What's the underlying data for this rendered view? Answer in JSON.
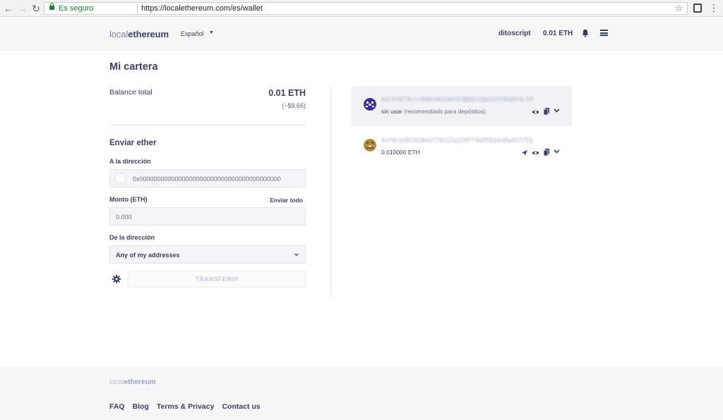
{
  "browser": {
    "secure_label": "Es seguro",
    "url": "https://localethereum.com/es/wallet"
  },
  "header": {
    "logo_light": "local",
    "logo_bold": "ethereum",
    "language": "Español",
    "username": "ditoscript",
    "balance": "0.01 ETH"
  },
  "wallet": {
    "title": "Mi cartera",
    "balance_label": "Balance total",
    "balance_value": "0.01 ETH",
    "balance_usd": "(~$9.66)"
  },
  "send": {
    "title": "Enviar ether",
    "to_label": "A la dirección",
    "to_placeholder": "0x0000000000000000000000000000000000000000",
    "amount_label": "Monto (ETH)",
    "send_all": "Enviar todo",
    "amount_placeholder": "0.000",
    "from_label": "De la dirección",
    "from_selected": "Any of my addresses",
    "transfer_button": "TRANSFERIR"
  },
  "addresses": [
    {
      "hash": "0xC03679cccA0010b146563B92CE8d165582EF4c10",
      "status": "sin usar",
      "note": "(recomendado para depósitos)",
      "identicon_color": "#3b2f99"
    },
    {
      "hash": "0xf0cb5EC028Ad729322a228ff4bFEE6448a0537Eb",
      "status": "0.010000 ETH",
      "note": "",
      "identicon_color": "#b38a3c"
    }
  ],
  "footer": {
    "logo_light": "local",
    "logo_bold": "ethereum",
    "links": [
      "FAQ",
      "Blog",
      "Terms & Privacy",
      "Contact us"
    ]
  }
}
